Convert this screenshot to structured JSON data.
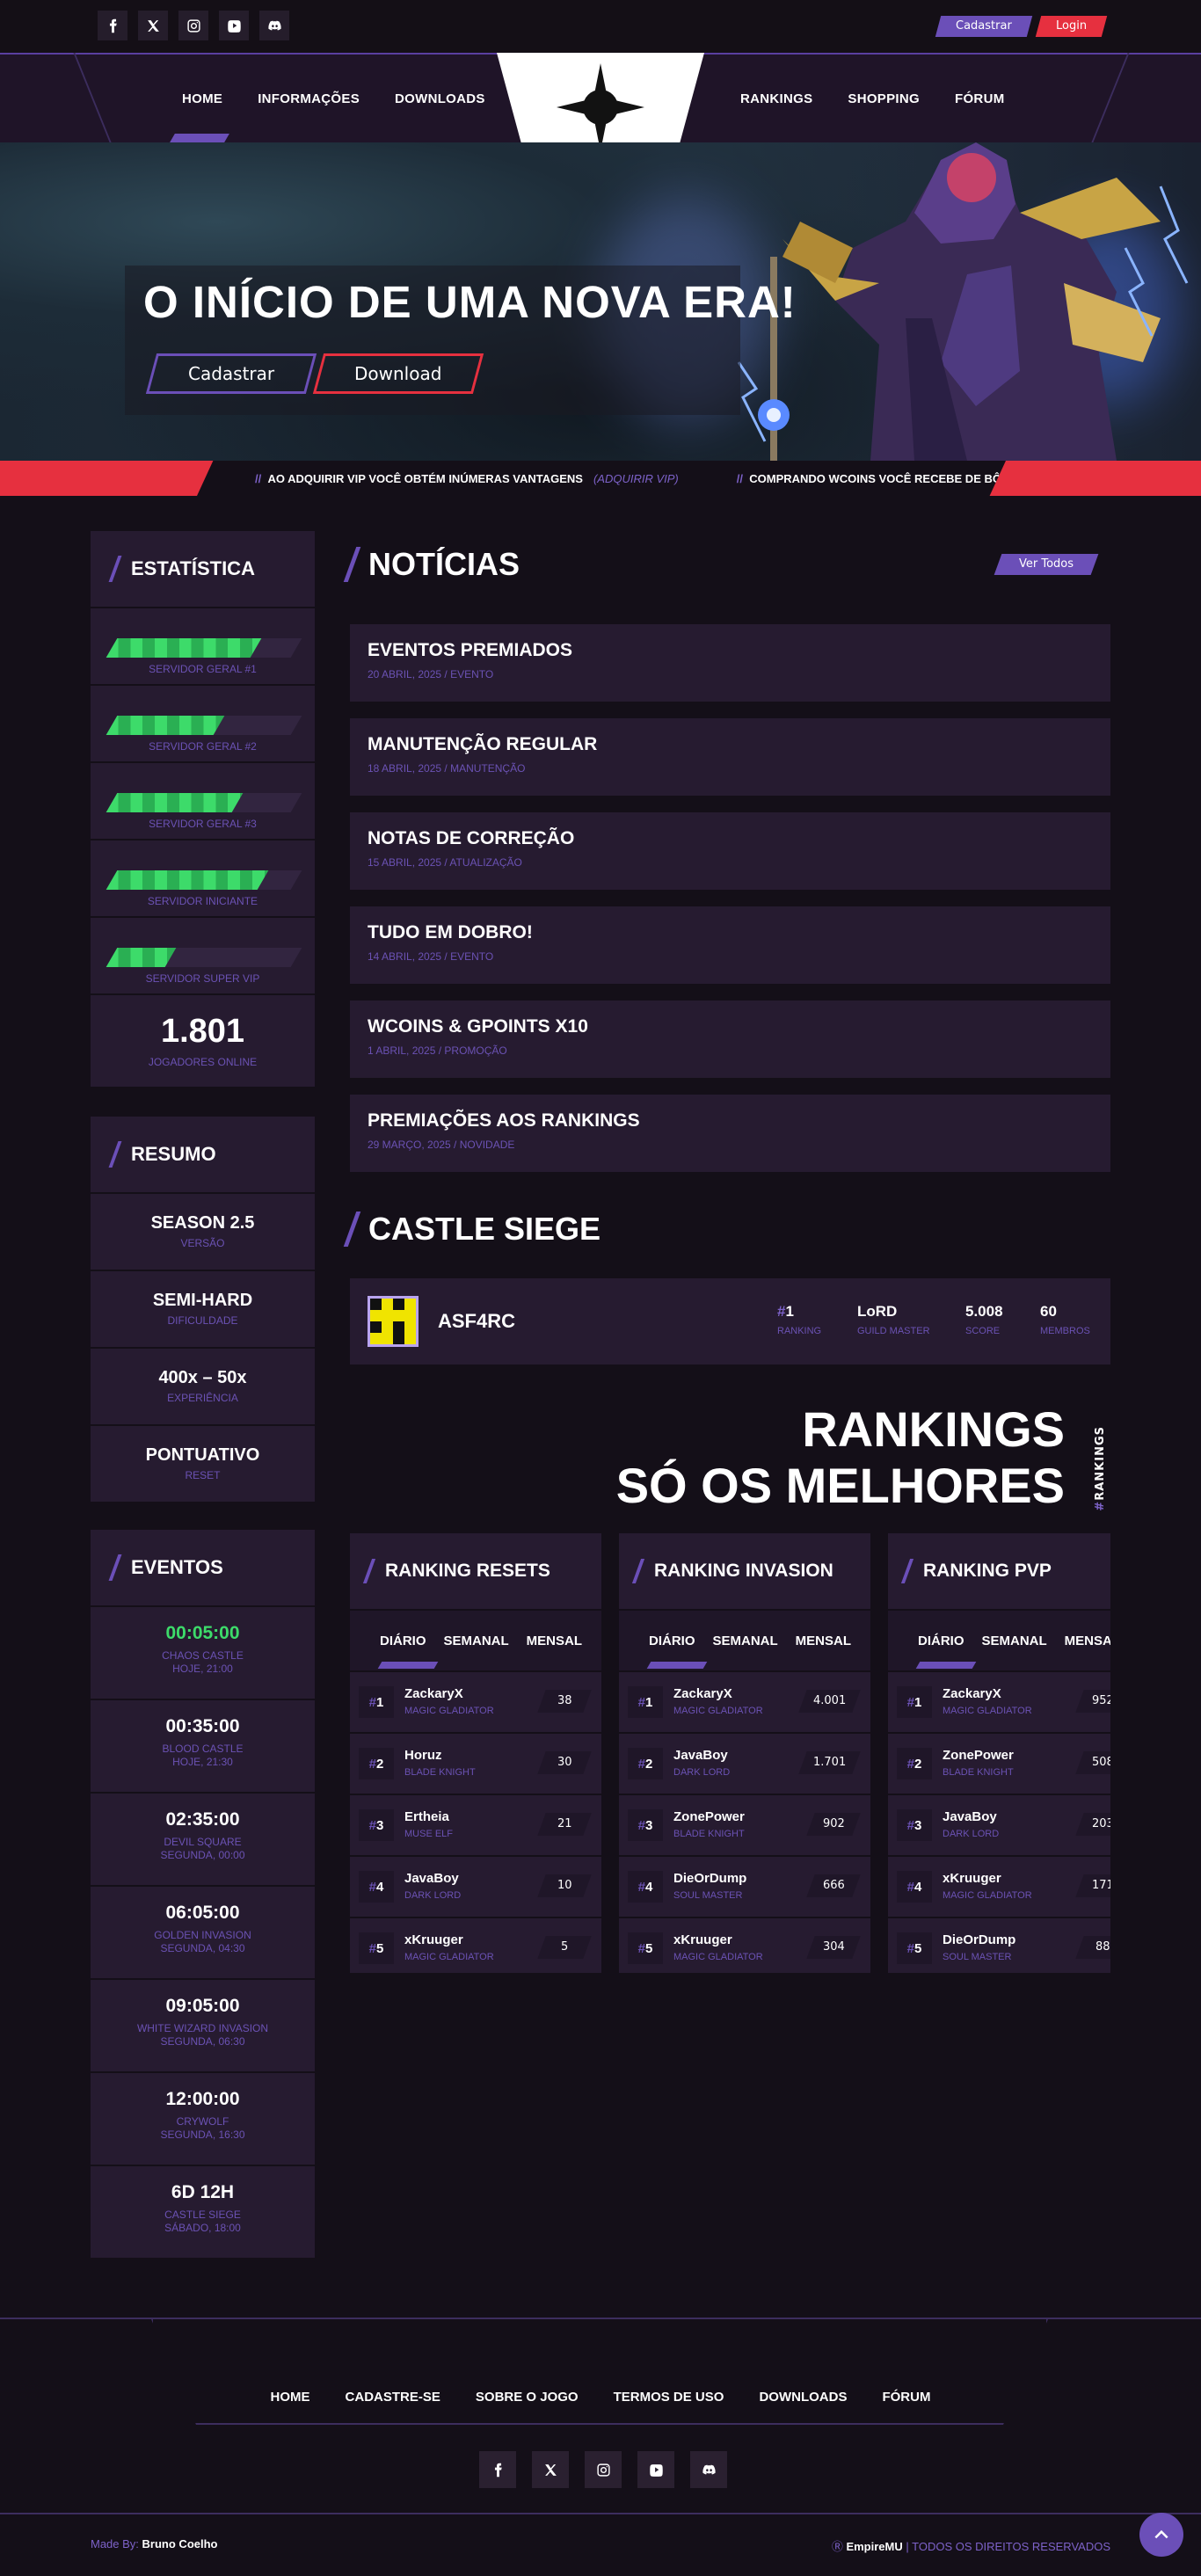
{
  "auth": {
    "register": "Cadastrar",
    "login": "Login"
  },
  "nav": {
    "left": [
      "HOME",
      "INFORMAÇÕES",
      "DOWNLOADS"
    ],
    "right": [
      "RANKINGS",
      "SHOPPING",
      "FÓRUM"
    ]
  },
  "hero": {
    "title": "O INÍCIO DE UMA NOVA ERA!",
    "btn_register": "Cadastrar",
    "btn_download": "Download"
  },
  "marquee": {
    "item1": "AO ADQUIRIR VIP VOCÊ OBTÉM INÚMERAS VANTAGENS",
    "item1_link": "(ADQUIRIR VIP)",
    "item2": "COMPRANDO WCOINS VOCÊ RECEBE DE BÔNUS X GI"
  },
  "stats": {
    "title": "ESTATÍSTICA",
    "servers": [
      {
        "name": "SERVIDOR GERAL #1",
        "load": 0.78
      },
      {
        "name": "SERVIDOR GERAL #2",
        "load": 0.58
      },
      {
        "name": "SERVIDOR GERAL #3",
        "load": 0.68
      },
      {
        "name": "SERVIDOR INICIANTE",
        "load": 0.82
      },
      {
        "name": "SERVIDOR SUPER VIP",
        "load": 0.32
      }
    ],
    "online": "1.801",
    "online_label": "JOGADORES ONLINE"
  },
  "summary": {
    "title": "RESUMO",
    "rows": [
      {
        "value": "SEASON 2.5",
        "label": "VERSÃO"
      },
      {
        "value": "SEMI-HARD",
        "label": "DIFICULDADE"
      },
      {
        "value": "400x – 50x",
        "label": "EXPERIÊNCIA"
      },
      {
        "value": "PONTUATIVO",
        "label": "RESET"
      }
    ]
  },
  "events": {
    "title": "EVENTOS",
    "rows": [
      {
        "time": "00:05:00",
        "name": "CHAOS CASTLE",
        "when": "HOJE, 21:00"
      },
      {
        "time": "00:35:00",
        "name": "BLOOD CASTLE",
        "when": "HOJE, 21:30"
      },
      {
        "time": "02:35:00",
        "name": "DEVIL SQUARE",
        "when": "SEGUNDA, 00:00"
      },
      {
        "time": "06:05:00",
        "name": "GOLDEN INVASION",
        "when": "SEGUNDA, 04:30"
      },
      {
        "time": "09:05:00",
        "name": "WHITE WIZARD INVASION",
        "when": "SEGUNDA, 06:30"
      },
      {
        "time": "12:00:00",
        "name": "CRYWOLF",
        "when": "SEGUNDA, 16:30"
      },
      {
        "time": "6D 12H",
        "name": "CASTLE SIEGE",
        "when": "SÁBADO, 18:00"
      }
    ]
  },
  "news": {
    "title": "NOTÍCIAS",
    "see_all": "Ver Todos",
    "items": [
      {
        "title": "EVENTOS PREMIADOS",
        "meta": "20 ABRIL, 2025 / EVENTO"
      },
      {
        "title": "MANUTENÇÃO REGULAR",
        "meta": "18 ABRIL, 2025 / MANUTENÇÃO"
      },
      {
        "title": "NOTAS DE CORREÇÃO",
        "meta": "15 ABRIL, 2025 / ATUALIZAÇÃO"
      },
      {
        "title": "TUDO EM DOBRO!",
        "meta": "14 ABRIL, 2025 / EVENTO"
      },
      {
        "title": "WCOINS & GPOINTS X10",
        "meta": "1 ABRIL, 2025 / PROMOÇÃO"
      },
      {
        "title": "PREMIAÇÕES AOS RANKINGS",
        "meta": "29 MARÇO, 2025 / NOVIDADE"
      }
    ]
  },
  "castle": {
    "title": "CASTLE SIEGE",
    "guild": "ASF4RC",
    "ranking": "1",
    "ranking_label": "RANKING",
    "master": "LoRD",
    "master_label": "GUILD MASTER",
    "score": "5.008",
    "score_label": "SCORE",
    "members": "60",
    "members_label": "MEMBROS"
  },
  "rankings": {
    "line1": "RANKINGS",
    "line2": "SÓ OS MELHORES",
    "vertical": "RANKINGS",
    "tabs": [
      "DIÁRIO",
      "SEMANAL",
      "MENSAL"
    ],
    "cards": [
      {
        "title": "RANKING RESETS",
        "rows": [
          {
            "pos": "1",
            "name": "ZackaryX",
            "cls": "MAGIC GLADIATOR",
            "score": "38"
          },
          {
            "pos": "2",
            "name": "Horuz",
            "cls": "BLADE KNIGHT",
            "score": "30"
          },
          {
            "pos": "3",
            "name": "Ertheia",
            "cls": "MUSE ELF",
            "score": "21"
          },
          {
            "pos": "4",
            "name": "JavaBoy",
            "cls": "DARK LORD",
            "score": "10"
          },
          {
            "pos": "5",
            "name": "xKruuger",
            "cls": "MAGIC GLADIATOR",
            "score": "5"
          }
        ]
      },
      {
        "title": "RANKING INVASION",
        "rows": [
          {
            "pos": "1",
            "name": "ZackaryX",
            "cls": "MAGIC GLADIATOR",
            "score": "4.001"
          },
          {
            "pos": "2",
            "name": "JavaBoy",
            "cls": "DARK LORD",
            "score": "1.701"
          },
          {
            "pos": "3",
            "name": "ZonePower",
            "cls": "BLADE KNIGHT",
            "score": "902"
          },
          {
            "pos": "4",
            "name": "DieOrDump",
            "cls": "SOUL MASTER",
            "score": "666"
          },
          {
            "pos": "5",
            "name": "xKruuger",
            "cls": "MAGIC GLADIATOR",
            "score": "304"
          }
        ]
      },
      {
        "title": "RANKING PVP",
        "rows": [
          {
            "pos": "1",
            "name": "ZackaryX",
            "cls": "MAGIC GLADIATOR",
            "score": "952"
          },
          {
            "pos": "2",
            "name": "ZonePower",
            "cls": "BLADE KNIGHT",
            "score": "508"
          },
          {
            "pos": "3",
            "name": "JavaBoy",
            "cls": "DARK LORD",
            "score": "203"
          },
          {
            "pos": "4",
            "name": "xKruuger",
            "cls": "MAGIC GLADIATOR",
            "score": "171"
          },
          {
            "pos": "5",
            "name": "DieOrDump",
            "cls": "SOUL MASTER",
            "score": "88"
          }
        ]
      }
    ]
  },
  "footer": {
    "links": [
      "HOME",
      "CADASTRE-SE",
      "SOBRE O JOGO",
      "TERMOS DE USO",
      "DOWNLOADS",
      "FÓRUM"
    ],
    "made_by_label": "Made By:",
    "made_by": "Bruno Coelho",
    "brand": "EmpireMU",
    "rights": "TODOS OS DIREITOS RESERVADOS"
  },
  "icons": [
    "facebook-icon",
    "x-icon",
    "instagram-icon",
    "youtube-icon",
    "discord-icon"
  ],
  "colors": {
    "accent": "#6b4fb8",
    "red": "#e6303f",
    "green": "#3ddb6a",
    "bg": "#140f18",
    "card": "#261b30"
  }
}
